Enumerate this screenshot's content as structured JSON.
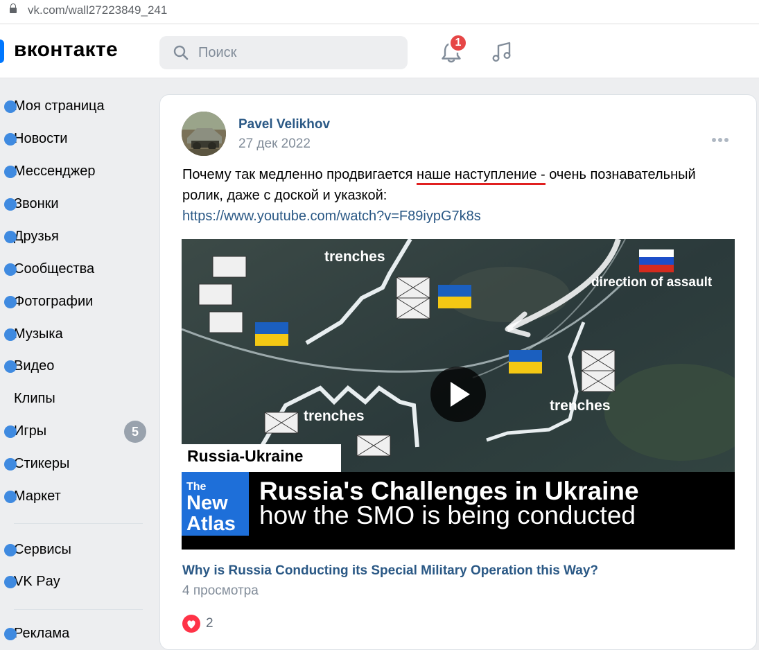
{
  "browser": {
    "url": "vk.com/wall27223849_241"
  },
  "header": {
    "logo": "вконтакте",
    "search_placeholder": "Поиск",
    "notifications_count": "1"
  },
  "sidebar": {
    "items": [
      {
        "label": "Моя страница",
        "icon": "user-icon"
      },
      {
        "label": "Новости",
        "icon": "news-icon"
      },
      {
        "label": "Мессенджер",
        "icon": "message-icon"
      },
      {
        "label": "Звонки",
        "icon": "phone-icon"
      },
      {
        "label": "Друзья",
        "icon": "friends-icon"
      },
      {
        "label": "Сообщества",
        "icon": "groups-icon"
      },
      {
        "label": "Фотографии",
        "icon": "photo-icon"
      },
      {
        "label": "Музыка",
        "icon": "music-icon"
      },
      {
        "label": "Видео",
        "icon": "video-icon"
      },
      {
        "label": "Клипы",
        "icon": "clips-icon"
      },
      {
        "label": "Игры",
        "icon": "games-icon",
        "count": "5"
      },
      {
        "label": "Стикеры",
        "icon": "stickers-icon"
      },
      {
        "label": "Маркет",
        "icon": "market-icon"
      },
      {
        "label": "Сервисы",
        "icon": "services-icon"
      },
      {
        "label": "VK Pay",
        "icon": "vkpay-icon"
      },
      {
        "label": "Реклама",
        "icon": "ads-icon"
      }
    ]
  },
  "post": {
    "author": "Pavel Velikhov",
    "date": "27 дек 2022",
    "text_before": "Почему так медленно продвигается ",
    "text_underlined": "наше наступление -",
    "text_after": " очень познавательный ролик, даже с доской и указкой:",
    "link": "https://www.youtube.com/watch?v=F89iypG7k8s",
    "video": {
      "label_trenches": "trenches",
      "label_direction": "direction of assault",
      "tag": "Russia-Ukraine",
      "brand_line1": "The",
      "brand_line2": "New",
      "brand_line3": "Atlas",
      "headline": "Russia's Challenges in Ukraine",
      "subheadline": "how the SMO is being conducted"
    },
    "video_title": "Why is Russia Conducting its Special Military Operation this Way?",
    "views": "4 просмотра",
    "likes": "2"
  },
  "colors": {
    "accent": "#2a5885",
    "brand": "#0077ff",
    "badge": "#e64646",
    "like": "#ff3347"
  }
}
